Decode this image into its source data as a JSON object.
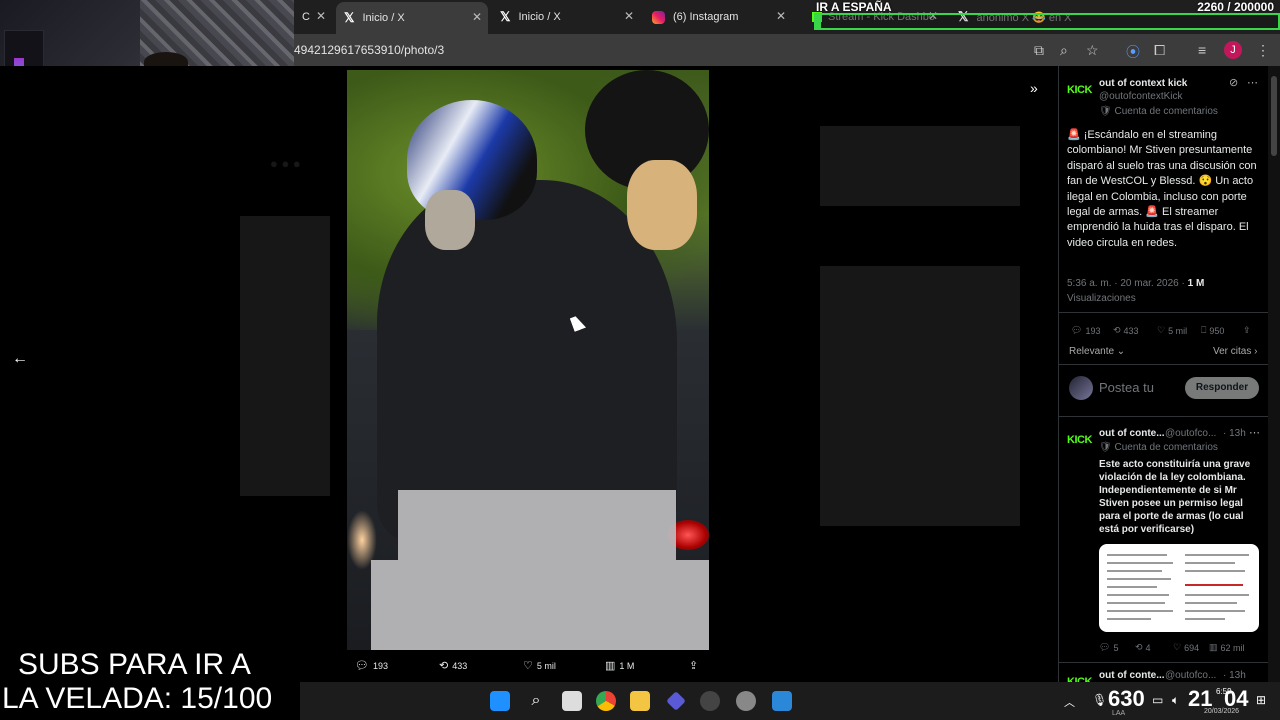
{
  "browser": {
    "tabs": [
      {
        "label": "C",
        "icon": "tab-partial-icon"
      },
      {
        "label": "Inicio / X",
        "icon": "x-logo-icon",
        "active": true
      },
      {
        "label": "Inicio / X",
        "icon": "x-logo-icon"
      },
      {
        "label": "(6) Instagram",
        "icon": "instagram-icon"
      },
      {
        "label": "Stream - Kick Dashbo",
        "icon": "kick-icon"
      },
      {
        "label": "anónimo X 😂 en X",
        "icon": "x-logo-icon"
      }
    ],
    "url": "4942129617653910/photo/3",
    "profile_initial": "J"
  },
  "overlay": {
    "goal_title": "IR A ESPAÑA",
    "goal_count": "2260 / 200000",
    "goal_progress": 0.0113,
    "accent_color": "#39d64a",
    "subs_line1": "SUBS PARA IR A",
    "subs_line2": "LA VELADA: 15/100"
  },
  "photo_actions": {
    "replies": "193",
    "reposts": "433",
    "likes": "5 mil",
    "views": "1 M"
  },
  "tweet": {
    "author": "out of context kick",
    "handle": "@outofcontextKick",
    "label": "Cuenta de comentarios",
    "text": "🚨 ¡Escándalo en el streaming colombiano! Mr Stiven presuntamente disparó al suelo tras una discusión con fan de WestCOL y Blessd. 😯 Un acto ilegal en Colombia, incluso con porte legal de armas. 🚨 El streamer emprendió la huida tras el disparo. El video circula en redes.",
    "time": "5:36 a. m. · 20 mar. 2026 · ",
    "views_count": "1 M",
    "views_label": "Visualizaciones",
    "stats": {
      "replies": "193",
      "reposts": "433",
      "likes": "5 mil",
      "bookmarks": "950"
    },
    "sort": "Relevante",
    "quotes": "Ver citas"
  },
  "reply_box": {
    "placeholder": "Postea tu",
    "button": "Responder"
  },
  "reply": {
    "author": "out of conte...",
    "handle": "@outofco...",
    "age": "· 13h",
    "label": "Cuenta de comentarios",
    "text": "Este acto constituiría una grave violación de la ley colombiana. Independientemente de si Mr Stiven posee un permiso legal para el porte de armas (lo cual está por verificarse)",
    "stats": {
      "replies": "5",
      "reposts": "4",
      "likes": "694",
      "views": "62 mil"
    }
  },
  "next_reply": {
    "author": "out of conte...",
    "handle": "@outofco...",
    "age": "· 13h"
  },
  "taskbar": {
    "viewer_count": "630",
    "viewer_label": "LAA",
    "clock": "6:59",
    "date": "20/03/2026",
    "timer_a": "21",
    "timer_b": "04"
  }
}
